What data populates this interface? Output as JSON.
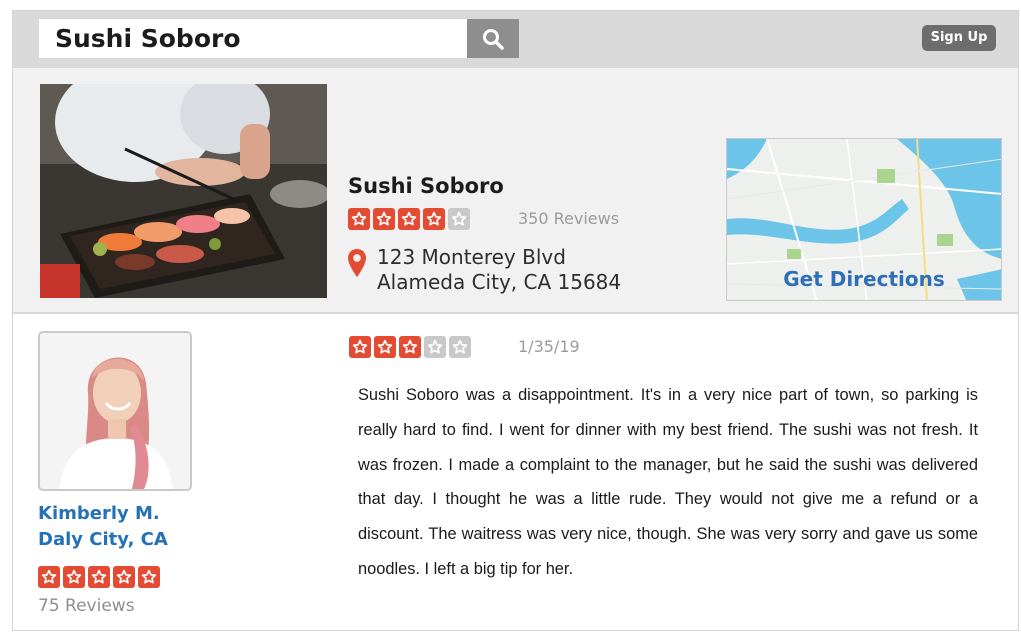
{
  "header": {
    "search_value": "Sushi Soboro",
    "search_icon": "search-icon",
    "signup_label": "Sign Up"
  },
  "business": {
    "name": "Sushi Soboro",
    "rating": 4,
    "max_rating": 5,
    "reviews": "350 Reviews",
    "address_line1": "123 Monterey Blvd",
    "address_line2": "Alameda City, CA 15684",
    "pin_icon": "map-pin-icon",
    "map_link": "Get Directions"
  },
  "reviewer": {
    "name": "Kimberly M.",
    "location": "Daly City, CA",
    "rating": 5,
    "reviews": "75 Reviews"
  },
  "review": {
    "rating": 3,
    "max_rating": 5,
    "date": "1/35/19",
    "text": "Sushi Soboro was a disappointment. It's in a very nice part of town, so parking is really hard to find. I went for dinner with my best friend. The sushi was not fresh. It was frozen. I made a complaint to the manager, but he said the sushi was delivered that day. I thought he was a little rude. They would not give me a refund or a discount. The waitress was very nice, though. She was very sorry and gave us some noodles. I left a big tip for her."
  },
  "colors": {
    "star_on": "#e44b33",
    "star_off": "#c9c9c9",
    "link_blue": "#2471b8",
    "topbar": "#d9d9d9"
  }
}
